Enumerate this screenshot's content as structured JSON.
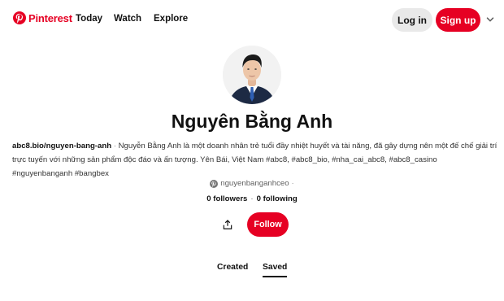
{
  "header": {
    "brand": "Pinterest",
    "brand_color": "#e60023",
    "nav": {
      "today": "Today",
      "watch": "Watch",
      "explore": "Explore"
    },
    "login_label": "Log in",
    "signup_label": "Sign up",
    "more_icon": "chevron-down-icon"
  },
  "profile": {
    "avatar_icon": "avatar",
    "name": "Nguyên Bằng Anh",
    "bio_link": "abc8.bio/nguyen-bang-anh",
    "bio_separator": "·",
    "bio_text": "Nguyễn Bằng Anh là một doanh nhân trẻ tuổi đầy nhiệt huyết và tài năng, đã gây dựng nên một đế chế giải trí trực tuyến với những sản phẩm độc đáo và ấn tượng. Yên Bái, Việt Nam #abc8, #abc8_bio, #nha_cai_abc8, #abc8_casino #nguyenbanganh #bangbex",
    "handle": "nguyenbanganhceo",
    "handle_icon": "pinterest-icon",
    "handle_dot": "·",
    "followers": "0 followers",
    "stats_separator": "·",
    "following": "0 following",
    "share_icon": "share-icon",
    "follow_label": "Follow"
  },
  "tabs": {
    "created": "Created",
    "saved": "Saved",
    "active": "Saved"
  }
}
